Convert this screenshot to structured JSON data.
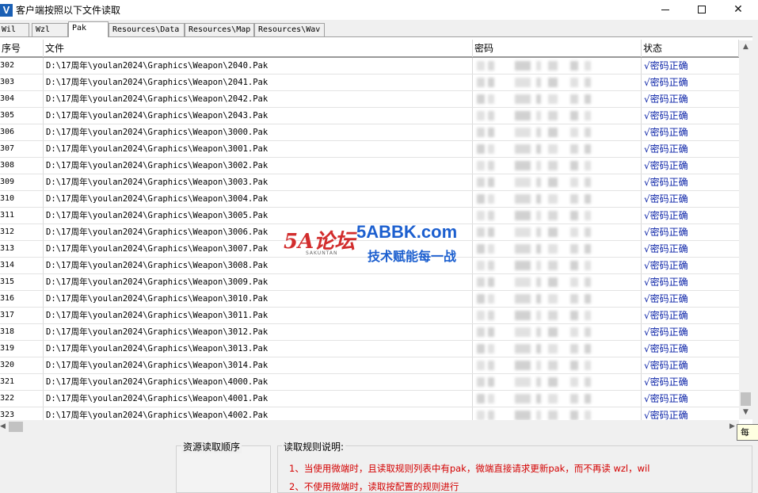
{
  "window": {
    "title": "客户端按照以下文件读取",
    "icon_letter": "V",
    "min_glyph": "—",
    "max_glyph": "☐",
    "close_glyph": "✕"
  },
  "tabs": [
    "Wil",
    "Wzl",
    "Pak",
    "Resources\\Data",
    "Resources\\Map",
    "Resources\\Wav"
  ],
  "active_tab": "Pak",
  "table": {
    "columns": {
      "no": "序号",
      "file": "文件",
      "password": "密码",
      "status": "状态"
    },
    "status_text": "√密码正确",
    "rows": [
      {
        "no": "302",
        "file": "D:\\17周年\\youlan2024\\Graphics\\Weapon\\2040.Pak"
      },
      {
        "no": "303",
        "file": "D:\\17周年\\youlan2024\\Graphics\\Weapon\\2041.Pak"
      },
      {
        "no": "304",
        "file": "D:\\17周年\\youlan2024\\Graphics\\Weapon\\2042.Pak"
      },
      {
        "no": "305",
        "file": "D:\\17周年\\youlan2024\\Graphics\\Weapon\\2043.Pak"
      },
      {
        "no": "306",
        "file": "D:\\17周年\\youlan2024\\Graphics\\Weapon\\3000.Pak"
      },
      {
        "no": "307",
        "file": "D:\\17周年\\youlan2024\\Graphics\\Weapon\\3001.Pak"
      },
      {
        "no": "308",
        "file": "D:\\17周年\\youlan2024\\Graphics\\Weapon\\3002.Pak"
      },
      {
        "no": "309",
        "file": "D:\\17周年\\youlan2024\\Graphics\\Weapon\\3003.Pak"
      },
      {
        "no": "310",
        "file": "D:\\17周年\\youlan2024\\Graphics\\Weapon\\3004.Pak"
      },
      {
        "no": "311",
        "file": "D:\\17周年\\youlan2024\\Graphics\\Weapon\\3005.Pak"
      },
      {
        "no": "312",
        "file": "D:\\17周年\\youlan2024\\Graphics\\Weapon\\3006.Pak"
      },
      {
        "no": "313",
        "file": "D:\\17周年\\youlan2024\\Graphics\\Weapon\\3007.Pak"
      },
      {
        "no": "314",
        "file": "D:\\17周年\\youlan2024\\Graphics\\Weapon\\3008.Pak"
      },
      {
        "no": "315",
        "file": "D:\\17周年\\youlan2024\\Graphics\\Weapon\\3009.Pak"
      },
      {
        "no": "316",
        "file": "D:\\17周年\\youlan2024\\Graphics\\Weapon\\3010.Pak"
      },
      {
        "no": "317",
        "file": "D:\\17周年\\youlan2024\\Graphics\\Weapon\\3011.Pak"
      },
      {
        "no": "318",
        "file": "D:\\17周年\\youlan2024\\Graphics\\Weapon\\3012.Pak"
      },
      {
        "no": "319",
        "file": "D:\\17周年\\youlan2024\\Graphics\\Weapon\\3013.Pak"
      },
      {
        "no": "320",
        "file": "D:\\17周年\\youlan2024\\Graphics\\Weapon\\3014.Pak"
      },
      {
        "no": "321",
        "file": "D:\\17周年\\youlan2024\\Graphics\\Weapon\\4000.Pak"
      },
      {
        "no": "322",
        "file": "D:\\17周年\\youlan2024\\Graphics\\Weapon\\4001.Pak"
      },
      {
        "no": "323",
        "file": "D:\\17周年\\youlan2024\\Graphics\\Weapon\\4002.Pak"
      }
    ]
  },
  "bottom": {
    "order_label": "资源读取顺序",
    "rules_label": "读取规则说明:",
    "rule1": "1、当使用微端时，且读取规则列表中有pak，微端直接请求更新pak，而不再读 wzl，wil",
    "rule2": "2、不使用微端时，读取按配置的规则进行"
  },
  "tooltip": "每",
  "watermark": {
    "logo": "5A论坛",
    "sub": "SAKUNTAN",
    "site": "5ABBK.com",
    "slogan": "技术赋能每一战"
  },
  "colors": {
    "status": "#0b23a8",
    "rules": "#d40000",
    "watermark_blue": "#1c5fcf",
    "watermark_red": "#d22d2d"
  },
  "scrollbar_arrows": {
    "up": "▲",
    "down": "▼",
    "left": "◀",
    "right": "▶"
  }
}
